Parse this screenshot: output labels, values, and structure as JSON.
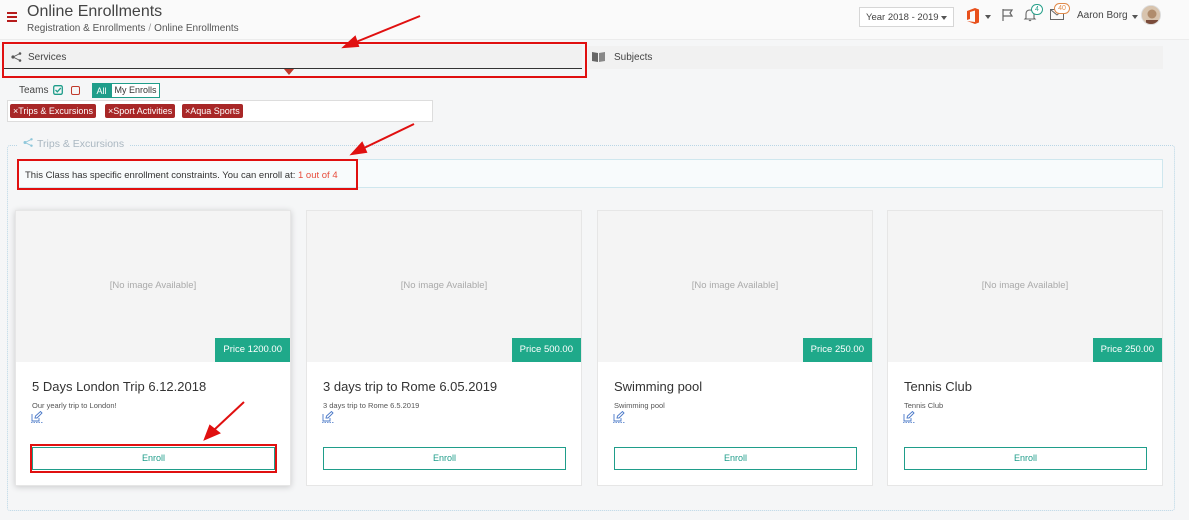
{
  "header": {
    "title": "Online Enrollments",
    "breadcrumb": [
      "Registration & Enrollments",
      "/",
      "Online Enrollments"
    ],
    "year_select": "Year 2018 - 2019",
    "notifications_count": "4",
    "messages_count": "40",
    "user_name": "Aaron Borg"
  },
  "tabs": {
    "services": "Services",
    "subjects": "Subjects"
  },
  "filters": {
    "teams_label": "Teams",
    "all_label": "All",
    "my_enrolls_label": "My Enrolls",
    "tags": [
      "×Trips & Excursions",
      "×Sport Activities",
      "×Aqua Sports"
    ]
  },
  "section": {
    "title": "Trips & Excursions",
    "alert_text": "This Class has specific enrollment constraints. You can enroll at: ",
    "alert_highlight": "1 out of 4"
  },
  "cards": [
    {
      "no_image": "[No image Available]",
      "price": "Price 1200.00",
      "title": "5 Days London Trip 6.12.2018",
      "desc": "Our yearly trip to London!",
      "enroll": "Enroll"
    },
    {
      "no_image": "[No image Available]",
      "price": "Price 500.00",
      "title": "3 days trip to Rome 6.05.2019",
      "desc": "3 days trip to Rome 6.5.2019",
      "enroll": "Enroll"
    },
    {
      "no_image": "[No image Available]",
      "price": "Price 250.00",
      "title": "Swimming pool",
      "desc": "Swimming pool",
      "enroll": "Enroll"
    },
    {
      "no_image": "[No image Available]",
      "price": "Price 250.00",
      "title": "Tennis Club",
      "desc": "Tennis Club",
      "enroll": "Enroll"
    }
  ],
  "colors": {
    "accent": "#1f9d8a",
    "tag": "#a82727",
    "annotation": "#e01010",
    "alert_highlight": "#e74c3c"
  }
}
